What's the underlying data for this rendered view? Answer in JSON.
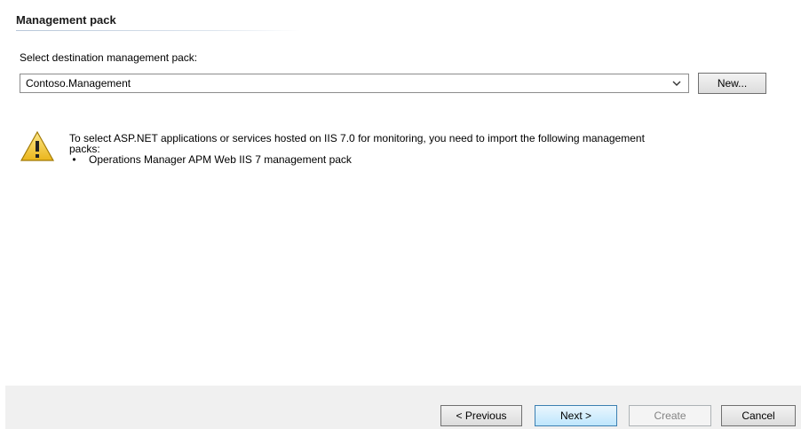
{
  "section": {
    "title": "Management pack"
  },
  "destination": {
    "label": "Select destination management pack:",
    "selected": "Contoso.Management",
    "new_button": "New..."
  },
  "warning": {
    "icon": "warning-triangle-icon",
    "line1": "To select ASP.NET applications or services hosted on IIS 7.0 for monitoring, you need to import the following management",
    "line2": "packs:",
    "items": [
      "Operations Manager APM Web IIS 7 management pack"
    ]
  },
  "footer": {
    "previous": "< Previous",
    "next": "Next >",
    "create": "Create",
    "cancel": "Cancel"
  },
  "colors": {
    "warning_yellow": "#f7d13a",
    "accent_blue": "#3c7fb1"
  }
}
